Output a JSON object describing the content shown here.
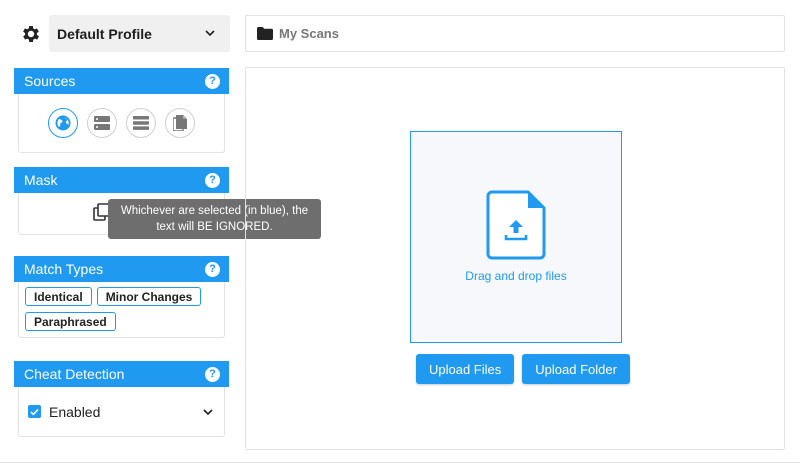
{
  "header": {
    "profile_label": "Default Profile",
    "path_label": "My Scans"
  },
  "sources": {
    "title": "Sources",
    "help": "?",
    "items": [
      {
        "icon": "globe-icon",
        "active": true
      },
      {
        "icon": "database-icon",
        "active": false
      },
      {
        "icon": "list-icon",
        "active": false
      },
      {
        "icon": "document-icon",
        "active": false
      }
    ]
  },
  "mask": {
    "title": "Mask",
    "help": "?",
    "icon": "copy-icon",
    "tooltip": "Whichever are selected (in blue), the text will BE IGNORED."
  },
  "match_types": {
    "title": "Match Types",
    "help": "?",
    "tags": [
      "Identical",
      "Minor Changes",
      "Paraphrased"
    ]
  },
  "cheat_detection": {
    "title": "Cheat Detection",
    "help": "?",
    "value": "Enabled",
    "checked": true
  },
  "upload": {
    "drop_label": "Drag and drop files",
    "files_button": "Upload Files",
    "folder_button": "Upload Folder"
  },
  "colors": {
    "accent": "#1f9af0",
    "tooltip_bg": "#6e6e6e"
  }
}
